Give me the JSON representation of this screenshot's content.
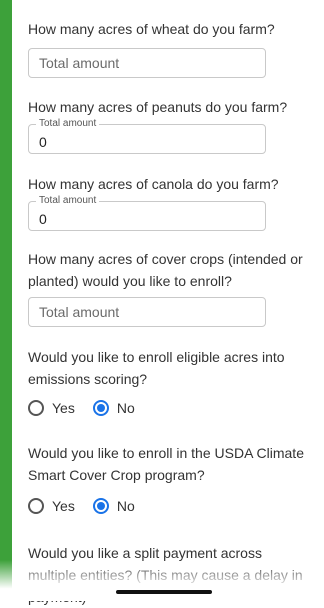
{
  "questions": {
    "wheat": {
      "text": "How many acres of wheat do you farm?",
      "placeholder": "Total amount"
    },
    "peanuts": {
      "text": "How many acres of peanuts do you farm?",
      "label": "Total amount",
      "value": "0"
    },
    "canola": {
      "text": "How many acres of canola do you farm?",
      "label": "Total amount",
      "value": "0"
    },
    "cover_crops": {
      "text": "How many acres of cover crops (intended or planted) would you like to enroll?",
      "placeholder": "Total amount"
    },
    "emissions": {
      "text": "Would you like to enroll eligible acres into emissions scoring?",
      "options": [
        "Yes",
        "No"
      ],
      "selected": "No"
    },
    "usda": {
      "text": "Would you like to enroll in the USDA Climate Smart Cover Crop program?",
      "options": [
        "Yes",
        "No"
      ],
      "selected": "No"
    },
    "split_payment": {
      "text": "Would you like a split payment across multiple entities? (This may cause a delay in payment)"
    }
  },
  "colors": {
    "accent_bar": "#3da13a",
    "radio_selected": "#1a73e8"
  }
}
